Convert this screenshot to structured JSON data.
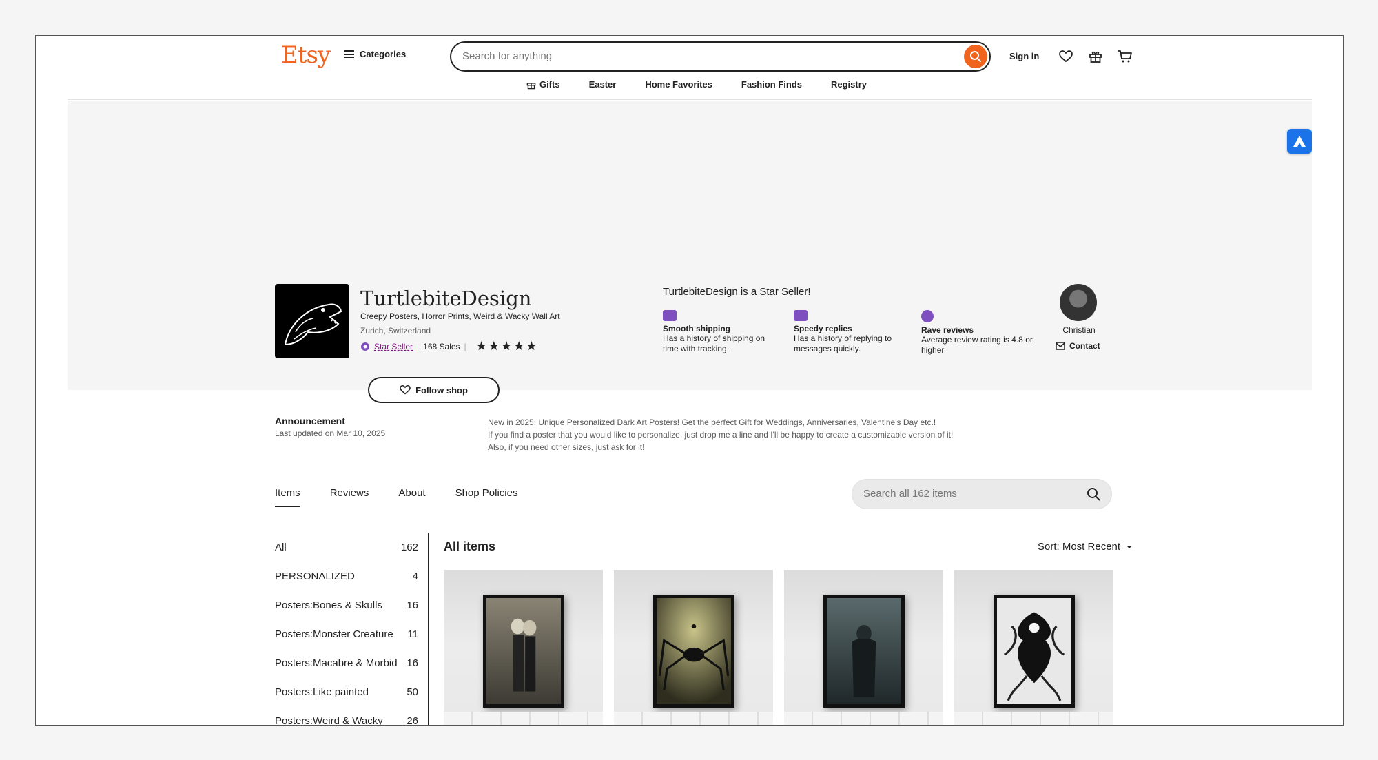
{
  "header": {
    "logo": "Etsy",
    "categories_label": "Categories",
    "search_placeholder": "Search for anything",
    "signin_label": "Sign in",
    "subnav": [
      {
        "label": "Gifts",
        "icon": "gift-icon"
      },
      {
        "label": "Easter"
      },
      {
        "label": "Home Favorites"
      },
      {
        "label": "Fashion Finds"
      },
      {
        "label": "Registry"
      }
    ]
  },
  "shop": {
    "name": "TurtlebiteDesign",
    "tagline": "Creepy Posters, Horror Prints, Weird & Wacky Wall Art",
    "location": "Zurich, Switzerland",
    "star_seller_label": "Star Seller",
    "sales": "168 Sales",
    "rating_stars": 5,
    "follow_label": "Follow shop",
    "star_heading": "TurtlebiteDesign is a Star Seller!",
    "features": [
      {
        "title": "Smooth shipping",
        "desc": "Has a history of shipping on time with tracking."
      },
      {
        "title": "Speedy replies",
        "desc": "Has a history of replying to messages quickly."
      },
      {
        "title": "Rave reviews",
        "desc": "Average review rating is 4.8 or higher"
      }
    ],
    "owner_name": "Christian",
    "contact_label": "Contact"
  },
  "announcement": {
    "title": "Announcement",
    "updated": "Last updated on Mar 10, 2025",
    "lines": [
      "New in 2025: Unique Personalized Dark Art Posters! Get the perfect Gift for Weddings, Anniversaries, Valentine's Day etc.!",
      "If you find a poster that you would like to personalize, just drop me a line and I'll be happy to create a customizable version of it!",
      "Also, if you need other sizes, just ask for it!"
    ]
  },
  "tabs": [
    "Items",
    "Reviews",
    "About",
    "Shop Policies"
  ],
  "item_search_placeholder": "Search all 162 items",
  "sections": [
    {
      "name": "All",
      "count": "162"
    },
    {
      "name": "PERSONALIZED",
      "count": "4"
    },
    {
      "name": "Posters:Bones & Skulls",
      "count": "16"
    },
    {
      "name": "Posters:Monster Creature",
      "count": "11"
    },
    {
      "name": "Posters:Macabre & Morbid",
      "count": "16"
    },
    {
      "name": "Posters:Like painted",
      "count": "50"
    },
    {
      "name": "Posters:Weird & Wacky",
      "count": "26"
    }
  ],
  "listing": {
    "heading": "All items",
    "sort_label": "Sort: Most Recent"
  },
  "colors": {
    "brand": "#f1641e",
    "star_seller": "#7f187f",
    "feature_icon": "#7f4fbf"
  }
}
